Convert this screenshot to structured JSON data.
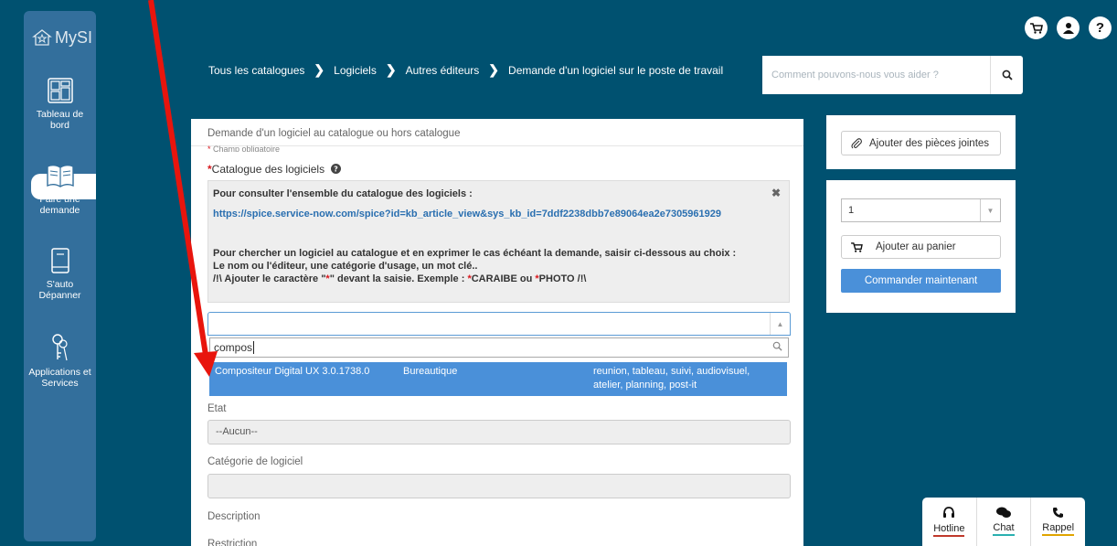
{
  "sidebar": {
    "logo_text": "MySI",
    "items": [
      {
        "label": "Tableau de bord"
      },
      {
        "label": "Faire une demande"
      },
      {
        "label": "S'auto Dépanner"
      },
      {
        "label": "Applications et Services"
      }
    ]
  },
  "breadcrumb": [
    "Tous les catalogues",
    "Logiciels",
    "Autres éditeurs",
    "Demande d'un logiciel sur le poste de travail"
  ],
  "search": {
    "placeholder": "Comment pouvons-nous vous aider ?"
  },
  "form": {
    "title": "Demande d'un logiciel au catalogue ou hors catalogue",
    "required_note": "Champ obligatoire",
    "catalogue_label": "Catalogue des logiciels",
    "info": {
      "line1": "Pour consulter l'ensemble du catalogue des logiciels :",
      "link": "https://spice.service-now.com/spice?id=kb_article_view&sys_kb_id=7ddf2238dbb7e89064ea2e7305961929",
      "line3": "Pour chercher un logiciel au catalogue et en exprimer le cas échéant la demande, saisir ci-dessous au choix :",
      "line4": "Le nom ou l'éditeur, une catégorie d'usage, un mot clé..",
      "line5_a": "/!\\ Ajouter le caractère \"",
      "line5_star": "*",
      "line5_b": "\" devant la saisie. Exemple : ",
      "line5_star2": "*",
      "line5_c": "CARAIBE ou ",
      "line5_star3": "*",
      "line5_d": "PHOTO /!\\"
    },
    "dropdown_search": "compos",
    "result": {
      "name": "Compositeur Digital UX 3.0.1738.0",
      "category": "Bureautique",
      "tags_line1": "reunion, tableau, suivi, audiovisuel,",
      "tags_line2": "atelier, planning, post-it"
    },
    "etat_label": "Etat",
    "etat_value": "--Aucun--",
    "categorie_label": "Catégorie de logiciel",
    "description_label": "Description",
    "restriction_label": "Restriction"
  },
  "right": {
    "attach_label": "Ajouter des pièces jointes",
    "quantity": "1",
    "add_cart_label": "Ajouter au panier",
    "order_label": "Commander maintenant"
  },
  "help": {
    "hotline": "Hotline",
    "chat": "Chat",
    "rappel": "Rappel"
  },
  "colors": {
    "background": "#005170",
    "sidebar": "#336f9c",
    "accent": "#4a90d9",
    "arrow": "#e8150d"
  }
}
